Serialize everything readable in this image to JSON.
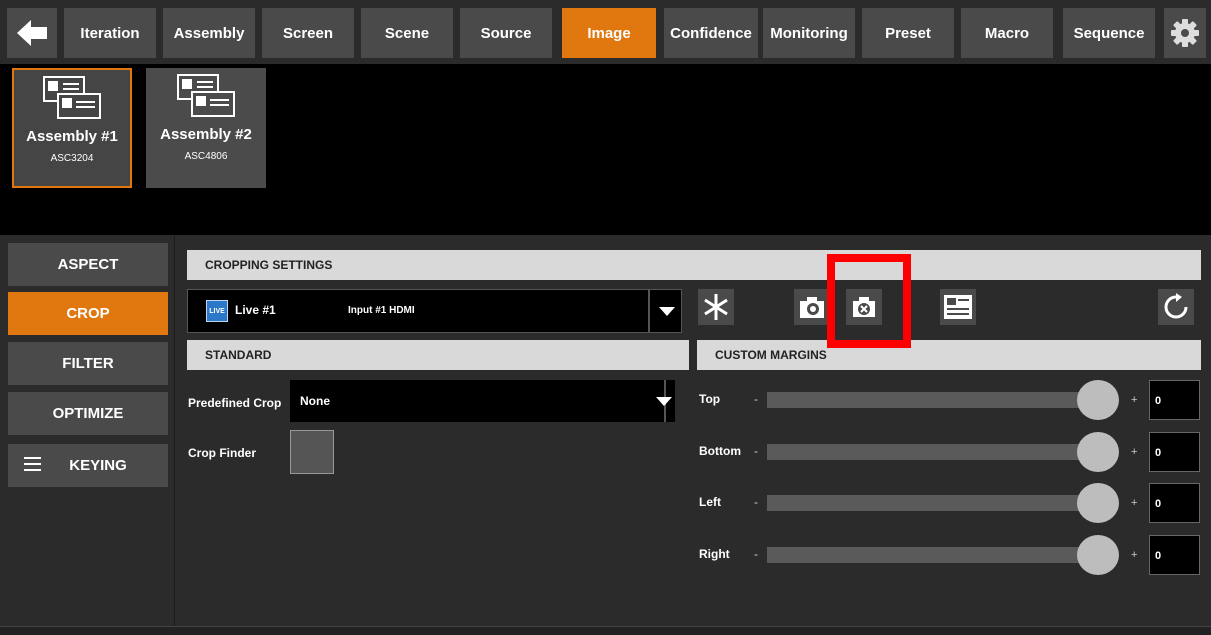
{
  "nav": {
    "back_icon": "back-arrow-icon",
    "items": [
      "Iteration",
      "Assembly",
      "Screen",
      "Scene",
      "Source",
      "Image",
      "Confidence",
      "Monitoring",
      "Preset",
      "Macro",
      "Sequence"
    ],
    "active": "Image",
    "settings_icon": "gear-icon"
  },
  "assemblies": [
    {
      "name": "Assembly #1",
      "id": "ASC3204",
      "selected": true
    },
    {
      "name": "Assembly #2",
      "id": "ASC4806",
      "selected": false
    }
  ],
  "sidebar": {
    "items": [
      "ASPECT",
      "CROP",
      "FILTER",
      "OPTIMIZE",
      "KEYING"
    ],
    "active": "CROP"
  },
  "cropping": {
    "header": "CROPPING SETTINGS",
    "source": {
      "badge": "LIVE",
      "name": "Live #1",
      "input": "Input #1 HDMI"
    }
  },
  "standard": {
    "header": "STANDARD",
    "predefined_label": "Predefined Crop",
    "predefined_value": "None",
    "finder_label": "Crop Finder"
  },
  "margins": {
    "header": "CUSTOM MARGINS",
    "rows": [
      {
        "label": "Top",
        "value": "0"
      },
      {
        "label": "Bottom",
        "value": "0"
      },
      {
        "label": "Left",
        "value": "0"
      },
      {
        "label": "Right",
        "value": "0"
      }
    ],
    "minus": "-",
    "plus": "+"
  },
  "colors": {
    "accent": "#e0780f",
    "highlight": "#ff0000",
    "panel": "#4a4a4a"
  }
}
